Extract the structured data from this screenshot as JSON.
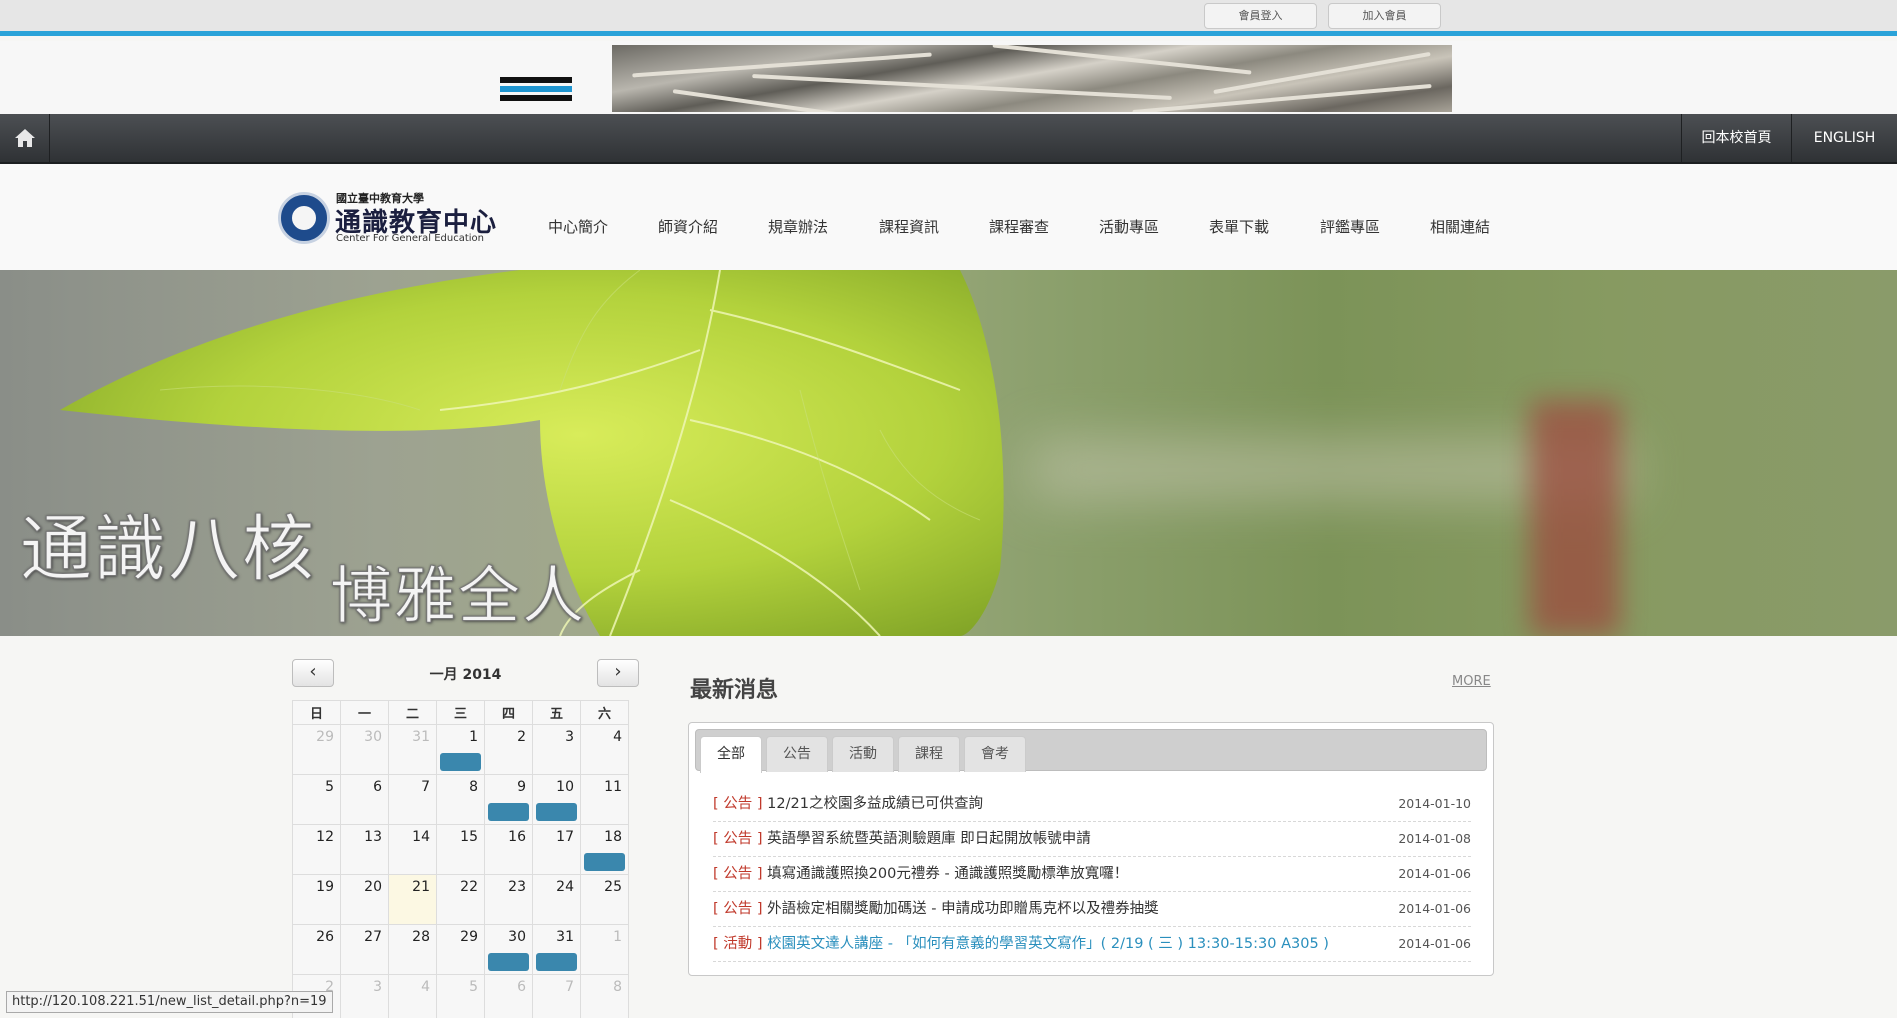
{
  "member": {
    "login_label": "會員登入",
    "join_label": "加入會員"
  },
  "topnav": {
    "school_home": "回本校首頁",
    "english": "ENGLISH"
  },
  "logo": {
    "small_text": "國立臺中教育大學",
    "title": "通識教育中心",
    "english": "Center For General Education"
  },
  "mainnav": {
    "items": [
      "中心簡介",
      "師資介紹",
      "規章辦法",
      "課程資訊",
      "課程審查",
      "活動專區",
      "表單下載",
      "評鑑專區",
      "相關連結"
    ]
  },
  "hero": {
    "line1": "通識八核",
    "line2": "博雅全人"
  },
  "calendar": {
    "title": "一月 2014",
    "weekdays": [
      "日",
      "一",
      "二",
      "三",
      "四",
      "五",
      "六"
    ],
    "weeks": [
      [
        "29",
        "30",
        "31",
        "1",
        "2",
        "3",
        "4"
      ],
      [
        "5",
        "6",
        "7",
        "8",
        "9",
        "10",
        "11"
      ],
      [
        "12",
        "13",
        "14",
        "15",
        "16",
        "17",
        "18"
      ],
      [
        "19",
        "20",
        "21",
        "22",
        "23",
        "24",
        "25"
      ],
      [
        "26",
        "27",
        "28",
        "29",
        "30",
        "31",
        "1"
      ],
      [
        "2",
        "3",
        "4",
        "5",
        "6",
        "7",
        "8"
      ]
    ]
  },
  "news": {
    "title": "最新消息",
    "more": "MORE",
    "tabs": [
      "全部",
      "公告",
      "活動",
      "課程",
      "會考"
    ],
    "items": [
      {
        "category": "[ 公告 ]",
        "title": "12/21之校園多益成績已可供查詢",
        "date": "2014-01-10"
      },
      {
        "category": "[ 公告 ]",
        "title": "英語學習系統暨英語測驗題庫 即日起開放帳號申請",
        "date": "2014-01-08"
      },
      {
        "category": "[ 公告 ]",
        "title": "填寫通識護照換200元禮券 - 通識護照獎勵標準放寬囉！",
        "date": "2014-01-06"
      },
      {
        "category": "[ 公告 ]",
        "title": "外語檢定相關獎勵加碼送 - 申請成功即贈馬克杯以及禮券抽獎",
        "date": "2014-01-06"
      },
      {
        "category": "[ 活動 ]",
        "title": "校園英文達人講座 - 「如何有意義的學習英文寫作」( 2/19 ( 三 ) 13:30-15:30 A305 )",
        "date": "2014-01-06"
      }
    ]
  },
  "status_url": "http://120.108.221.51/new_list_detail.php?n=19"
}
